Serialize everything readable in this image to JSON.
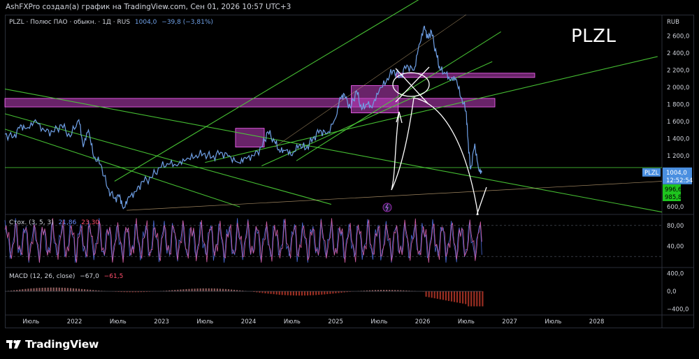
{
  "header": {
    "text": "AshFXPro создал(а) график на TradingView.com, Сен 01, 2026 10:57 UTC+3"
  },
  "symbol": {
    "ticker": "PLZL",
    "watermark": "PLZL",
    "legend_name": "PLZL · Полюс ПАО · обыкн. · 1Д · RUS",
    "last_price": "1004,0",
    "change": "−39,8 (−3,81%)",
    "currency": "RUB"
  },
  "price_tags": {
    "symbol_tag": "PLZL",
    "last": "1004,0",
    "countdown": "12:52:54",
    "tag_green_1": "996,6",
    "tag_green_2": "985,8"
  },
  "stoch_legend": {
    "name": "Стох. (3, 5, 3)",
    "k": "21,86",
    "d": "23,30"
  },
  "macd_legend": {
    "name": "MACD (12, 26, close)",
    "macd": "−67,0",
    "signal": "−61,5"
  },
  "footer": {
    "logo_text": "TradingView"
  },
  "colors": {
    "price_line": "#6fa0e6",
    "trend_green": "#4cd137",
    "zone_magenta": "#c040c0",
    "stoch_pink": "#d35ea5",
    "stoch_blue": "#4a6bd8",
    "macd_hist_up": "#b07070",
    "macd_hist_down": "#c0392b",
    "last_price_tag": "#4a8fe0",
    "green_tag": "#1ec41e"
  },
  "chart_data": [
    {
      "type": "line",
      "pane": "price",
      "title": "PLZL · Полюс ПАО · обыкн. · 1Д · RUS",
      "y_axis_unit": "RUB",
      "y_ticks": [
        600,
        1000,
        1200,
        1400,
        1600,
        1800,
        2000,
        2200,
        2400,
        2600
      ],
      "y_tick_labels": [
        "600,0",
        "1 000,0",
        "1 200,0",
        "1 400,0",
        "1 600,0",
        "1 800,0",
        "2 000,0",
        "2 200,0",
        "2 400,0",
        "2 600,0"
      ],
      "x_ticks": [
        "Июль",
        "2022",
        "Июль",
        "2023",
        "Июль",
        "2024",
        "Июль",
        "2025",
        "Июль",
        "2026",
        "Июль",
        "2027",
        "Июль",
        "2028"
      ],
      "x_tick_values": [
        2021.5,
        2022.0,
        2022.5,
        2023.0,
        2023.5,
        2024.0,
        2024.5,
        2025.0,
        2025.5,
        2026.0,
        2026.5,
        2027.0,
        2027.5,
        2028.0
      ],
      "ylim": [
        520,
        2850
      ],
      "xlim": [
        2021.2,
        2028.75
      ],
      "grid": false,
      "series": [
        {
          "name": "PLZL",
          "x": [
            2021.2,
            2021.3,
            2021.38,
            2021.45,
            2021.55,
            2021.65,
            2021.75,
            2021.85,
            2021.95,
            2022.05,
            2022.1,
            2022.16,
            2022.22,
            2022.3,
            2022.38,
            2022.46,
            2022.52,
            2022.56,
            2022.62,
            2022.7,
            2022.78,
            2022.88,
            2022.98,
            2023.08,
            2023.18,
            2023.28,
            2023.38,
            2023.48,
            2023.58,
            2023.68,
            2023.78,
            2023.88,
            2023.96,
            2024.05,
            2024.15,
            2024.22,
            2024.3,
            2024.36,
            2024.42,
            2024.5,
            2024.58,
            2024.66,
            2024.74,
            2024.82,
            2024.9,
            2025.0,
            2025.05,
            2025.1,
            2025.17,
            2025.24,
            2025.3,
            2025.36,
            2025.42,
            2025.5,
            2025.58,
            2025.66,
            2025.74,
            2025.82,
            2025.9,
            2025.96,
            2026.02,
            2026.06,
            2026.1,
            2026.16,
            2026.2,
            2026.26,
            2026.32,
            2026.38,
            2026.44,
            2026.5,
            2026.52,
            2026.55,
            2026.6,
            2026.64,
            2026.68
          ],
          "y": [
            1450,
            1420,
            1560,
            1520,
            1620,
            1500,
            1480,
            1560,
            1420,
            1620,
            1300,
            1500,
            1180,
            1100,
            820,
            700,
            740,
            580,
            720,
            780,
            900,
            940,
            1060,
            1100,
            1080,
            1150,
            1180,
            1220,
            1180,
            1240,
            1200,
            1120,
            1180,
            1200,
            1300,
            1480,
            1360,
            1240,
            1260,
            1200,
            1320,
            1280,
            1400,
            1500,
            1460,
            1640,
            1880,
            1920,
            1760,
            1960,
            1740,
            1800,
            1760,
            1960,
            2060,
            2200,
            2120,
            2260,
            2200,
            2500,
            2720,
            2580,
            2660,
            2380,
            2200,
            2160,
            2080,
            2100,
            1880,
            1720,
            1400,
            1040,
            1340,
            1060,
            1004
          ]
        }
      ],
      "zones": [
        {
          "x0": 2021.2,
          "x1": 2028.3,
          "y0": 1770,
          "y1": 1870
        },
        {
          "x0": 2025.7,
          "x1": 2028.9,
          "y0": 2115,
          "y1": 2165
        },
        {
          "x0": 2025.18,
          "x1": 2025.72,
          "y0": 1700,
          "y1": 2020
        },
        {
          "x0": 2023.85,
          "x1": 2024.18,
          "y0": 1300,
          "y1": 1520
        }
      ],
      "annotations": [
        "PLZL"
      ]
    },
    {
      "type": "line",
      "pane": "stochastic",
      "title": "Стох. (3, 5, 3)",
      "y_ticks": [
        40,
        80
      ],
      "y_tick_labels": [
        "40,00",
        "80,00"
      ],
      "ylim": [
        0,
        100
      ],
      "series": [
        {
          "name": "%K",
          "last": 21.86
        },
        {
          "name": "%D",
          "last": 23.3
        }
      ]
    },
    {
      "type": "bar",
      "pane": "macd",
      "title": "MACD (12, 26, close)",
      "y_ticks": [
        -400,
        0,
        400
      ],
      "y_tick_labels": [
        "−400,0",
        "0,0",
        "400,0"
      ],
      "ylim": [
        -550,
        520
      ],
      "series": [
        {
          "name": "MACD",
          "last": -67.0
        },
        {
          "name": "Signal",
          "last": -61.5
        }
      ]
    }
  ]
}
